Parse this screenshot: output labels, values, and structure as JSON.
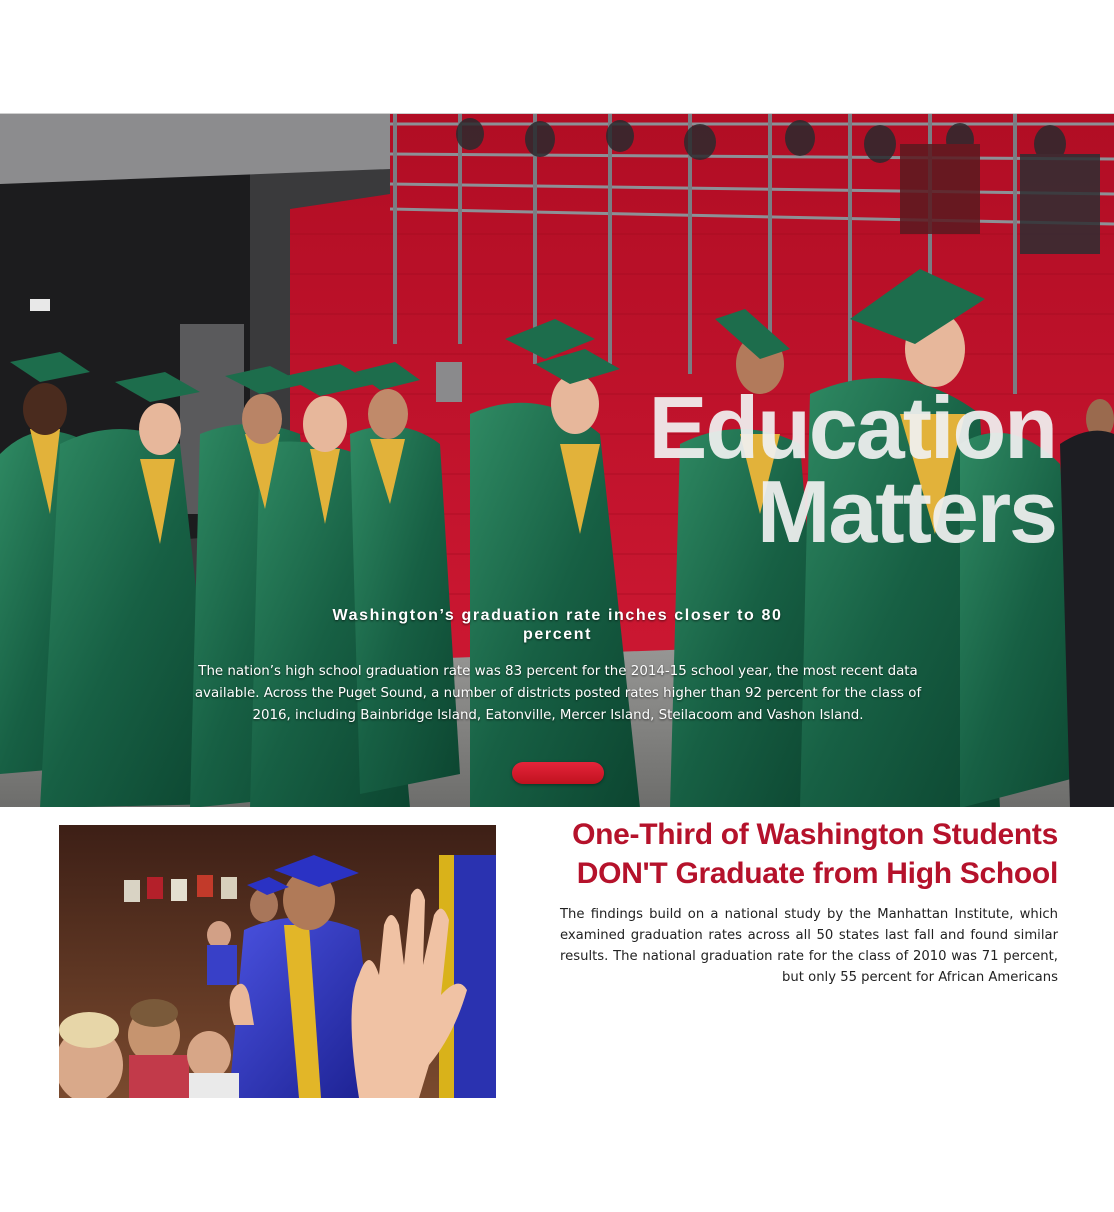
{
  "hero": {
    "title_line1": "Education",
    "title_line2": "Matters",
    "subtitle": "Washington’s graduation rate inches closer to 80 percent",
    "body": "The nation’s high school graduation rate was 83 percent for the 2014-15 school year, the most recent data available. Across the Puget Sound, a number of districts posted rates higher than 92 percent for the class of 2016, including Bainbridge Island, Eatonville, Mercer Island, Steilacoom and Vashon Island.",
    "cta_color": "#d81e2f",
    "photo_icon": "graduation-procession-photo"
  },
  "article": {
    "headline_line1": "One-Third of Washington Students",
    "headline_line2": "DON'T Graduate from High School",
    "body": "The findings build on a national study by the Manhattan Institute, which examined graduation rates across all 50 states last fall and found similar results. The national graduation rate for the class of 2010 was 71 percent, but only 55 percent for African Americans",
    "photo_icon": "graduate-high-five-photo"
  },
  "colors": {
    "accent_red": "#b5122b",
    "wall_red": "#c4122e",
    "gown_green": "#1f6b4a",
    "stole_gold": "#e2b23a",
    "gown_blue": "#2d35b8"
  }
}
